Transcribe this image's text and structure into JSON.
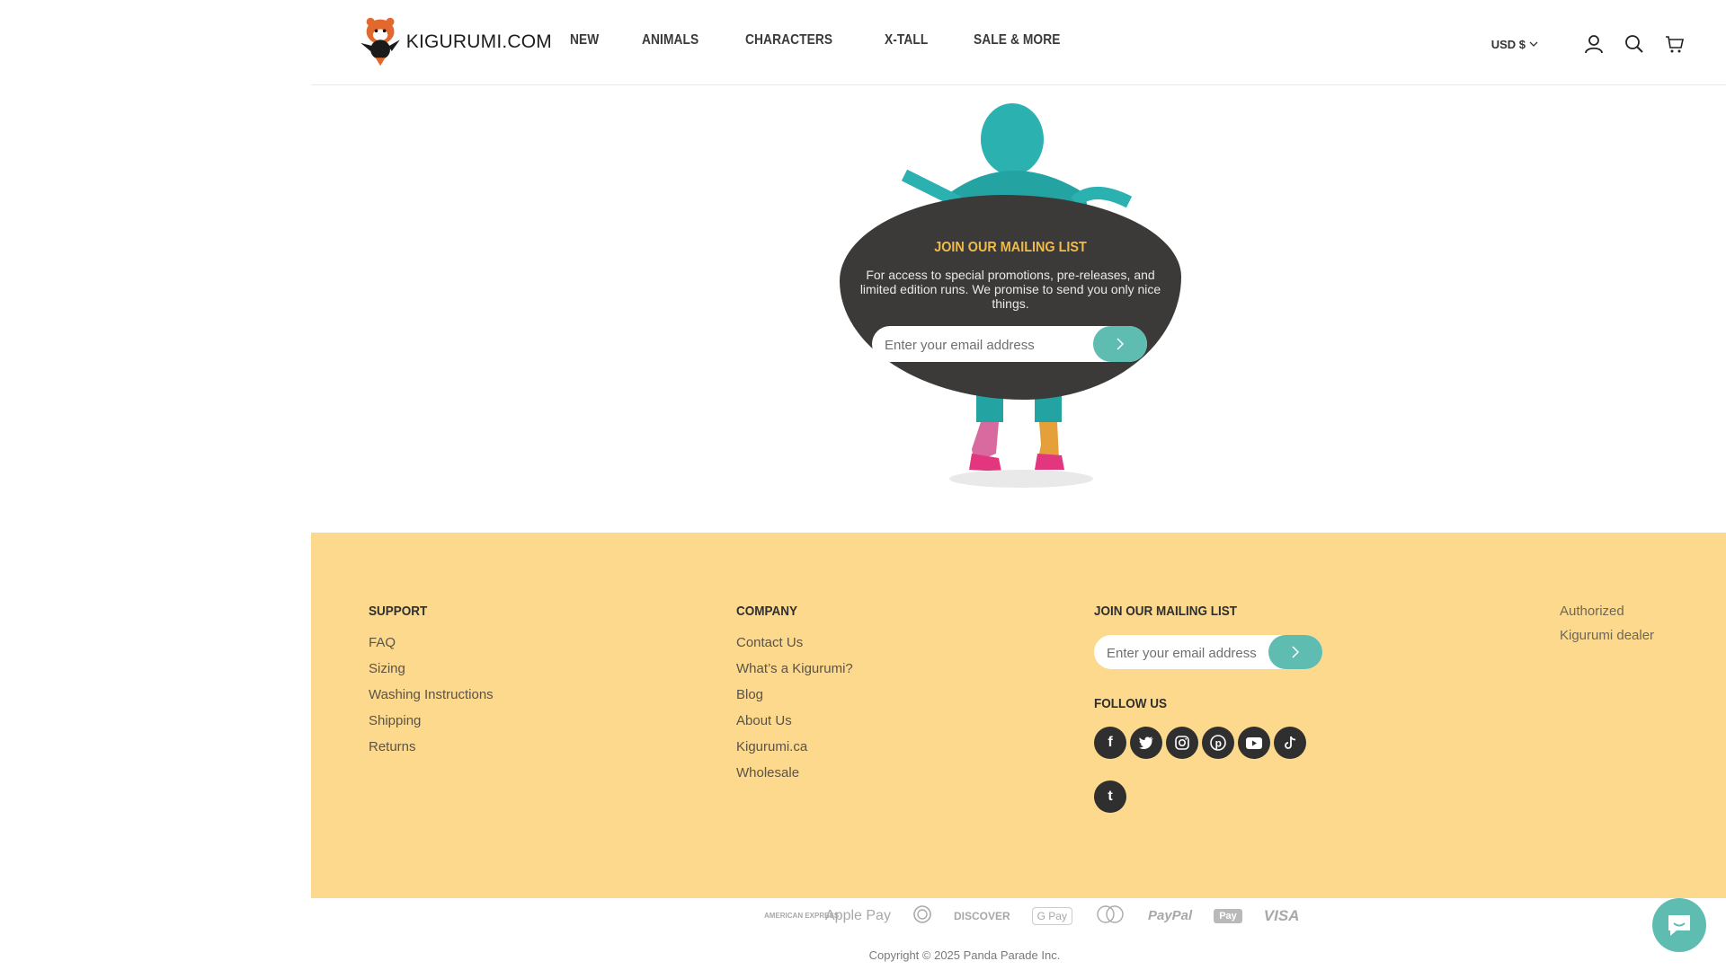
{
  "header": {
    "logo_text": "KIGURUMI.COM",
    "nav": [
      "NEW",
      "ANIMALS",
      "CHARACTERS",
      "X-TALL",
      "SALE & MORE"
    ],
    "currency": "USD $",
    "icons": [
      "account-icon",
      "search-icon",
      "cart-icon"
    ]
  },
  "hero": {
    "title": "JOIN OUR MAILING LIST",
    "text": "For access to special promotions, pre-releases, and limited edition runs. We promise to send you only nice things.",
    "email_placeholder": "Enter your email address"
  },
  "footer": {
    "support": {
      "title": "SUPPORT",
      "links": [
        "FAQ",
        "Sizing",
        "Washing Instructions",
        "Shipping",
        "Returns"
      ]
    },
    "company": {
      "title": "COMPANY",
      "links": [
        "Contact Us",
        "What’s a Kigurumi?",
        "Blog",
        "About Us",
        "Kigurumi.ca",
        "Wholesale"
      ]
    },
    "mailing": {
      "title": "JOIN OUR MAILING LIST",
      "email_placeholder": "Enter your email address"
    },
    "follow": {
      "title": "FOLLOW US",
      "socials": [
        "facebook-icon",
        "twitter-icon",
        "instagram-icon",
        "pinterest-icon",
        "youtube-icon",
        "tiktok-icon",
        "tumblr-icon"
      ]
    },
    "dealer_alt": "Authorized Kigurumi dealer"
  },
  "payments": [
    "AMERICAN EXPRESS",
    "Apple Pay",
    "Diners",
    "DISCOVER",
    "G Pay",
    "mastercard",
    "PayPal",
    "Pay",
    "VISA"
  ],
  "copyright": "Copyright © 2025 Panda Parade Inc.",
  "colors": {
    "accent": "#5fbcb1",
    "footer_bg": "#fcd98c",
    "title_yellow": "#f0bb4a",
    "blob": "#3b3a39"
  }
}
